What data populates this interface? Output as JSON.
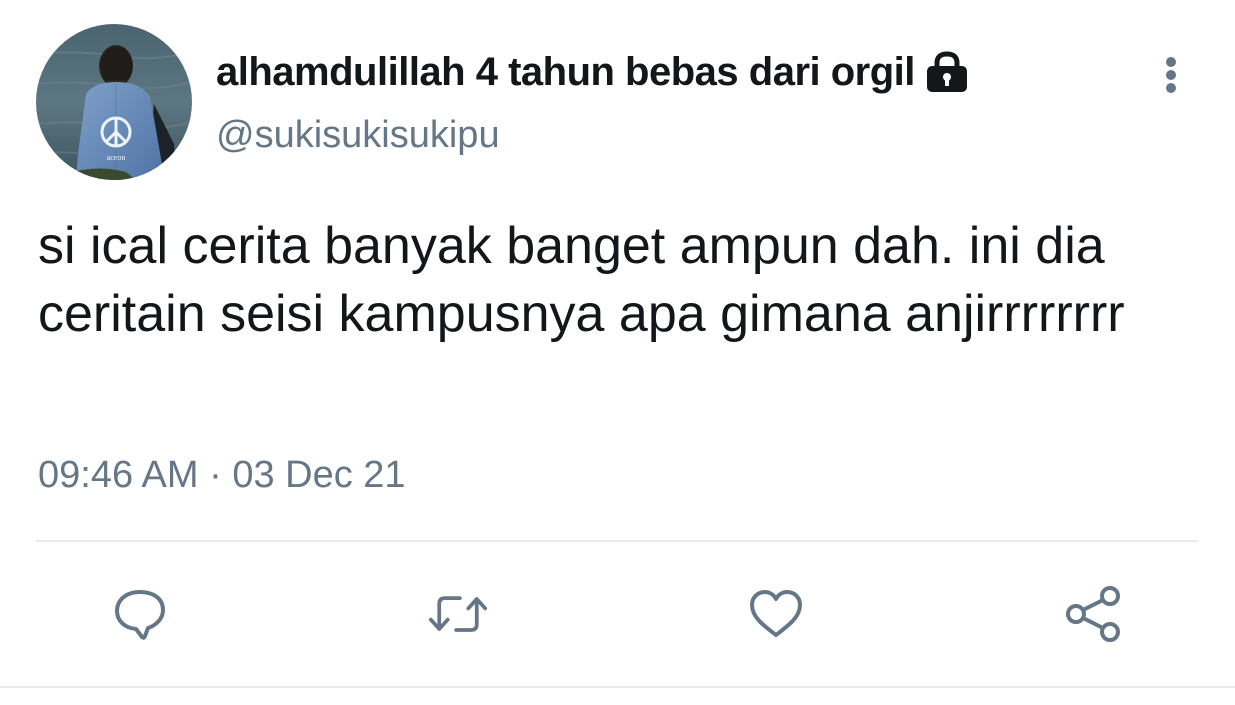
{
  "tweet": {
    "display_name": "alhamdulillah 4 tahun bebas dari orgil",
    "handle": "@sukisukisukipu",
    "text": "si ical cerita banyak banget ampun dah. ini dia ceritain seisi kampusnya apa gimana anjirrrrrrrr",
    "timestamp": "09:46 AM · 03 Dec 21",
    "protected_icon": "lock-icon",
    "avatar_badge_text": "aceon"
  },
  "actions": [
    {
      "name": "reply",
      "icon": "comment-icon"
    },
    {
      "name": "retweet",
      "icon": "retweet-icon"
    },
    {
      "name": "like",
      "icon": "heart-icon"
    },
    {
      "name": "share",
      "icon": "share-icon"
    }
  ],
  "colors": {
    "primary_text": "#14171a",
    "secondary_text": "#657786",
    "icon": "#657786",
    "divider": "#e6ecf0"
  }
}
